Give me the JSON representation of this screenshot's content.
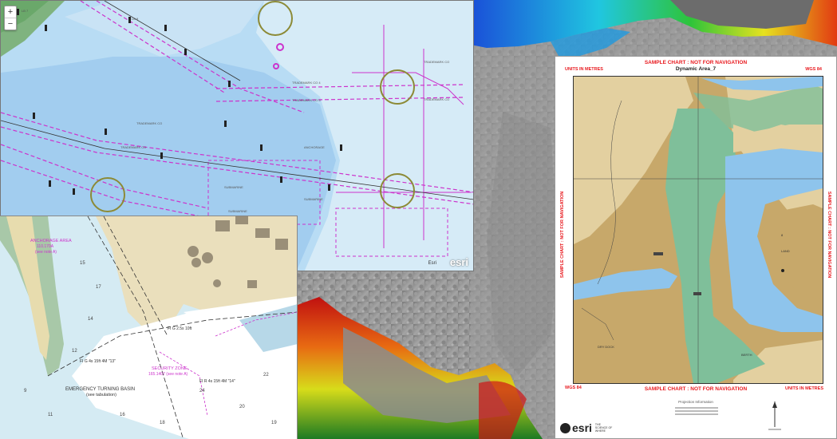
{
  "enc_map": {
    "zoom_in": "+",
    "zoom_out": "−",
    "attribution": "Esri",
    "logo": "esri"
  },
  "paper_chart": {
    "anchorage_label": "ANCHORAGE AREA",
    "anchorage_ref": "110.170A",
    "anchorage_sub": "(see note A)",
    "turning_basin": "EMERGENCY TURNING BASIN",
    "turning_basin_sub": "(see tabulation)",
    "security_zone": "SECURITY ZONE",
    "security_zone_ref": "165.1407 (see note A)",
    "light_1": "FI G 2.5s 10ft",
    "light_2": "FI R 4s 15ft 4M \"14\"",
    "light_3": "FI G 4s 15ft 4M \"13\""
  },
  "sample_chart": {
    "banner_top": "SAMPLE CHART : NOT FOR NAVIGATION",
    "banner_bottom": "SAMPLE CHART : NOT FOR NAVIGATION",
    "banner_side": "SAMPLE CHART : NOT FOR NAVIGATION",
    "title": "Dynamic Area_7",
    "units_left": "UNITS IN METRES",
    "units_right": "UNITS IN METRES",
    "datum_left": "WGS 84",
    "datum_right": "WGS 84",
    "logo": "esri",
    "tagline": "THE SCIENCE OF WHERE",
    "projection_header": "Projection Information"
  },
  "colors": {
    "enc_water": "#b8dcf4",
    "enc_deep": "#cfe8f6",
    "chart_land": "#c7a86a",
    "chart_channel": "#7fbf9a",
    "chart_water": "#8ec4ec",
    "esri_accent": "#e8191e"
  }
}
